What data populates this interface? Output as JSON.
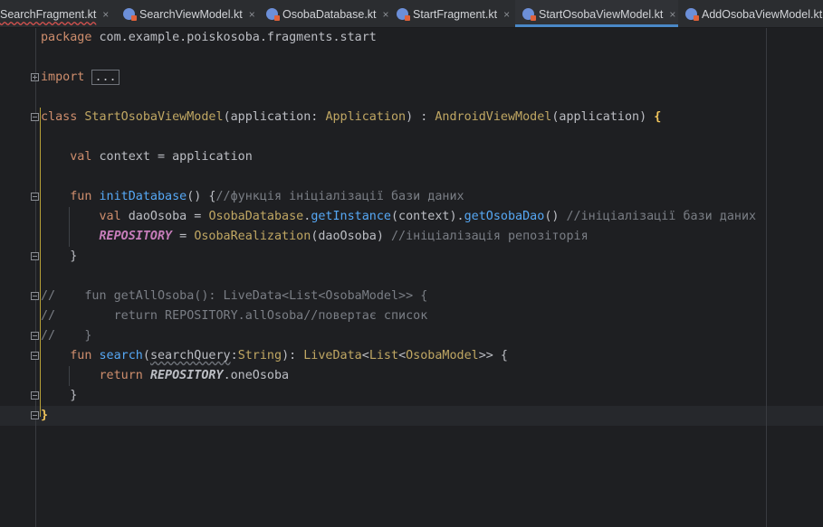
{
  "tabs": [
    {
      "name": "SearchFragment.kt",
      "active": false
    },
    {
      "name": "SearchViewModel.kt",
      "active": false
    },
    {
      "name": "OsobaDatabase.kt",
      "active": false
    },
    {
      "name": "StartFragment.kt",
      "active": false
    },
    {
      "name": "StartOsobaViewModel.kt",
      "active": true
    },
    {
      "name": "AddOsobaViewModel.kt",
      "active": false
    }
  ],
  "close_glyph": "×",
  "code": {
    "l1": {
      "kw": "package",
      "rest": " com.example.poiskosoba.fragments.start"
    },
    "l3": {
      "kw": "import",
      "folded": "..."
    },
    "l5": {
      "kw": "class",
      "name": "StartOsobaViewModel",
      "p1": "(application: ",
      "type": "Application",
      "p2": ") : ",
      "super": "AndroidViewModel",
      "p3": "(application) ",
      "brace": "{"
    },
    "l7": {
      "kw": "val",
      "rest": " context = application"
    },
    "l9": {
      "kw": "fun",
      "name": "initDatabase",
      "p1": "() {",
      "comment": "//функція ініціалізації бази даних"
    },
    "l10": {
      "kw": "val",
      "v1": " daoOsoba = ",
      "obj": "OsobaDatabase",
      "dot1": ".",
      "m1": "getInstance",
      "a1": "(context).",
      "m2": "getOsobaDao",
      "a2": "() ",
      "comment": "//ініціалізації бази даних"
    },
    "l11": {
      "prop": "REPOSITORY",
      "eq": " = ",
      "cls": "OsobaRealization",
      "args": "(daoOsoba) ",
      "comment": "//ініціалізація репозіторія"
    },
    "l12": {
      "text": "}"
    },
    "l14": {
      "text": "//    fun getAllOsoba(): LiveData<List<OsobaModel>> {"
    },
    "l15": {
      "text": "//        return REPOSITORY.allOsoba//повертає список"
    },
    "l16": {
      "text": "//    }"
    },
    "l17": {
      "kw": "fun",
      "name": "search",
      "p1": "(",
      "param": "searchQuery",
      "p2": ":",
      "t1": "String",
      "p3": "): ",
      "t2": "LiveData",
      "lt1": "<",
      "t3": "List",
      "lt2": "<",
      "t4": "OsobaModel",
      "gt": ">> {"
    },
    "l18": {
      "kw": "return",
      "sp": " ",
      "prop": "REPOSITORY",
      "rest": ".oneOsoba"
    },
    "l19": {
      "text": "}"
    },
    "l20": {
      "text": "}"
    }
  },
  "colors": {
    "background": "#1e1f22",
    "keyword": "#cf8e6d",
    "function": "#56a8f5",
    "class": "#c0a763",
    "comment": "#7a7e85",
    "accent": "#4a88c7"
  }
}
